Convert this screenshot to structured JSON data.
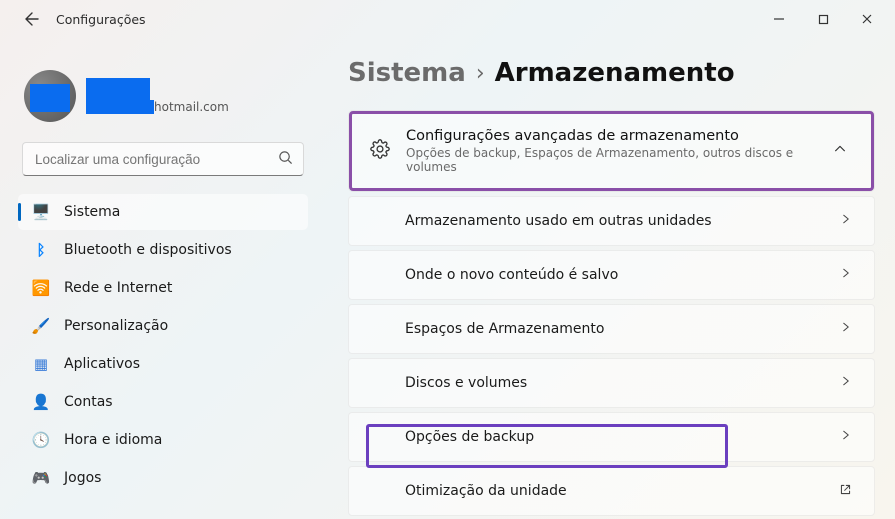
{
  "app": {
    "title": "Configurações"
  },
  "profile": {
    "email_suffix": "hotmail.com"
  },
  "search": {
    "placeholder": "Localizar uma configuração"
  },
  "sidebar": {
    "items": [
      {
        "label": "Sistema",
        "icon": "💻",
        "color": "#0379d9"
      },
      {
        "label": "Bluetooth e dispositivos",
        "icon": "ᛒ",
        "color": "#0a84ff"
      },
      {
        "label": "Rede e Internet",
        "icon": "◆",
        "color": "#00a7e1"
      },
      {
        "label": "Personalização",
        "icon": "✎",
        "color": "#7b61ff"
      },
      {
        "label": "Aplicativos",
        "icon": "▦",
        "color": "#3b7dd8"
      },
      {
        "label": "Contas",
        "icon": "👤",
        "color": "#4aa564"
      },
      {
        "label": "Hora e idioma",
        "icon": "🕒",
        "color": "#4aa0e6"
      },
      {
        "label": "Jogos",
        "icon": "🎮",
        "color": "#777"
      }
    ]
  },
  "breadcrumb": {
    "parent": "Sistema",
    "current": "Armazenamento"
  },
  "advanced": {
    "title": "Configurações avançadas de armazenamento",
    "subtitle": "Opções de backup, Espaços de Armazenamento, outros discos e volumes"
  },
  "rows": [
    {
      "label": "Armazenamento usado em outras unidades",
      "action": "chevron"
    },
    {
      "label": "Onde o novo conteúdo é salvo",
      "action": "chevron"
    },
    {
      "label": "Espaços de Armazenamento",
      "action": "chevron"
    },
    {
      "label": "Discos e volumes",
      "action": "chevron"
    },
    {
      "label": "Opções de backup",
      "action": "chevron"
    },
    {
      "label": "Otimização da unidade",
      "action": "external"
    }
  ]
}
